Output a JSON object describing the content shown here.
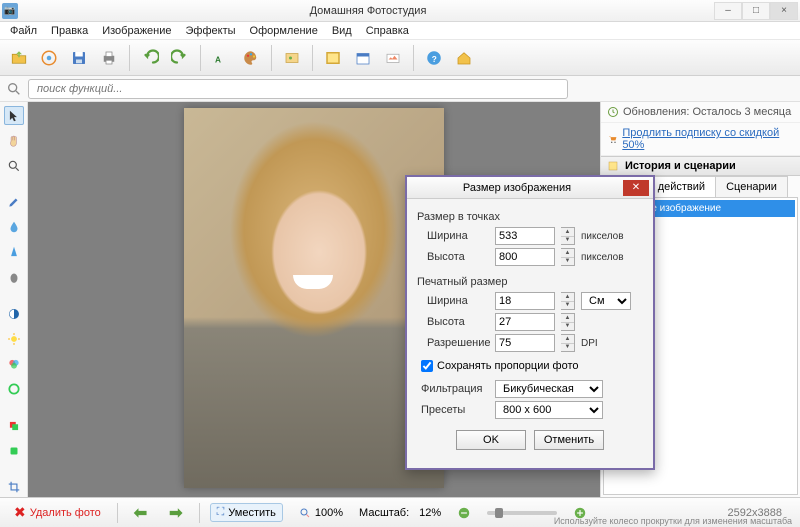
{
  "window": {
    "title": "Домашняя Фотостудия",
    "minimize": "–",
    "maximize": "□",
    "close": "×"
  },
  "menu": {
    "file": "Файл",
    "edit": "Правка",
    "image": "Изображение",
    "effects": "Эффекты",
    "design": "Оформление",
    "view": "Вид",
    "help": "Справка"
  },
  "search": {
    "placeholder": "поиск функций..."
  },
  "right": {
    "update_label": "Обновления: Осталось  3 месяца",
    "promo_link": "Продлить подписку со скидкой 50%",
    "panel_title": "История и сценарии",
    "tab_history": "История действий",
    "tab_scenarios": "Сценарии",
    "history_item0": "Исходное изображение"
  },
  "dialog": {
    "title": "Размер изображения",
    "section_px": "Размер в точках",
    "width_label": "Ширина",
    "height_label": "Высота",
    "px_width": "533",
    "px_height": "800",
    "px_unit": "пикселов",
    "section_print": "Печатный размер",
    "pr_width": "18",
    "pr_height": "27",
    "pr_unit": "См",
    "res_label": "Разрешение",
    "res_value": "75",
    "res_unit": "DPI",
    "keep_ratio": "Сохранять пропорции фото",
    "filter_label": "Фильтрация",
    "filter_value": "Бикубическая",
    "preset_label": "Пресеты",
    "preset_value": "800 x 600",
    "ok": "OK",
    "cancel": "Отменить"
  },
  "status": {
    "delete": "Удалить фото",
    "fit": "Уместить",
    "zoom100": "100%",
    "scale_label": "Масштаб:",
    "scale_value": "12%",
    "dimensions": "2592x3888",
    "hint": "Используйте колесо прокрутки для изменения масштаба"
  }
}
